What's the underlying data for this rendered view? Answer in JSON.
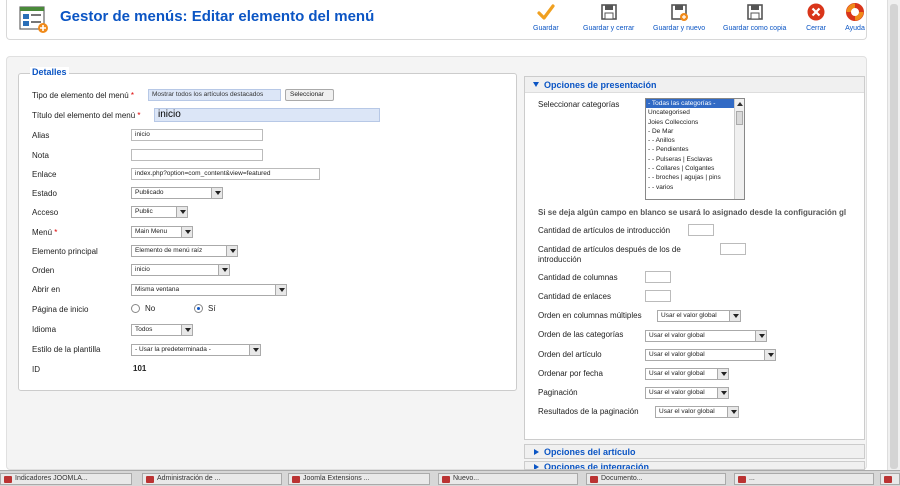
{
  "header": {
    "title": "Gestor de menús: Editar elemento del menú"
  },
  "toolbar": {
    "save": "Guardar",
    "save_close": "Guardar y cerrar",
    "save_new": "Guardar y nuevo",
    "save_copy": "Guardar como copia",
    "close": "Cerrar",
    "help": "Ayuda"
  },
  "details": {
    "legend": "Detalles",
    "menu_item_type_label": "Tipo de elemento del menú",
    "menu_item_type_value": "Mostrar todos los artículos destacados",
    "select_button": "Seleccionar",
    "title_label": "Título del elemento del menú",
    "title_value": "inicio",
    "alias_label": "Alias",
    "alias_value": "inicio",
    "note_label": "Nota",
    "note_value": "",
    "link_label": "Enlace",
    "link_value": "index.php?option=com_content&view=featured",
    "status_label": "Estado",
    "status_value": "Publicado",
    "access_label": "Acceso",
    "access_value": "Public",
    "menu_label": "Menú",
    "menu_value": "Main Menu",
    "parent_label": "Elemento principal",
    "parent_value": "Elemento de menú raíz",
    "order_label": "Orden",
    "order_value": "inicio",
    "open_in_label": "Abrir en",
    "open_in_value": "Misma ventana",
    "home_label": "Página de inicio",
    "home_no": "No",
    "home_yes": "Sí",
    "language_label": "Idioma",
    "language_value": "Todos",
    "template_style_label": "Estilo de la plantilla",
    "template_style_value": "- Usar la predeterminada -",
    "id_label": "ID",
    "id_value": "101"
  },
  "presentation": {
    "title": "Opciones de presentación",
    "categories_label": "Seleccionar categorías",
    "categories": [
      "- Todas las categorías -",
      "Uncategorised",
      "Joies Colleccions",
      "- De Mar",
      "- - Anillos",
      "- - Pendientes",
      "- - Pulseras | Esclavas",
      "- - Collares | Colgantes",
      "- - broches | agujas | pins",
      "- - varios"
    ],
    "note": "Si se deja algún campo en blanco se usará lo asignado desde la configuración gl",
    "intro_count_label": "Cantidad de artículos de introducción",
    "after_intro_label_1": "Cantidad de artículos después de los de",
    "after_intro_label_2": "introducción",
    "columns_label": "Cantidad de columnas",
    "links_label": "Cantidad de enlaces",
    "multi_col_order_label": "Orden en columnas múltiples",
    "multi_col_order_value": "Usar el valor global",
    "cat_order_label": "Orden de las categorías",
    "cat_order_value": "Usar el valor global",
    "article_order_label": "Orden del artículo",
    "article_order_value": "Usar el valor global",
    "date_order_label": "Ordenar por fecha",
    "date_order_value": "Usar el valor global",
    "pagination_label": "Paginación",
    "pagination_value": "Usar el valor global",
    "pagination_results_label": "Resultados de la paginación",
    "pagination_results_value": "Usar el valor global"
  },
  "accordions": {
    "article_options": "Opciones del artículo",
    "integration_options": "Opciones de integración"
  },
  "taskbar": {
    "items": [
      "Indicadores JOOMLA...",
      "Administración de ...",
      "Joomla Extensions ...",
      "Nuevo...",
      "Documento...",
      "...",
      ""
    ]
  }
}
